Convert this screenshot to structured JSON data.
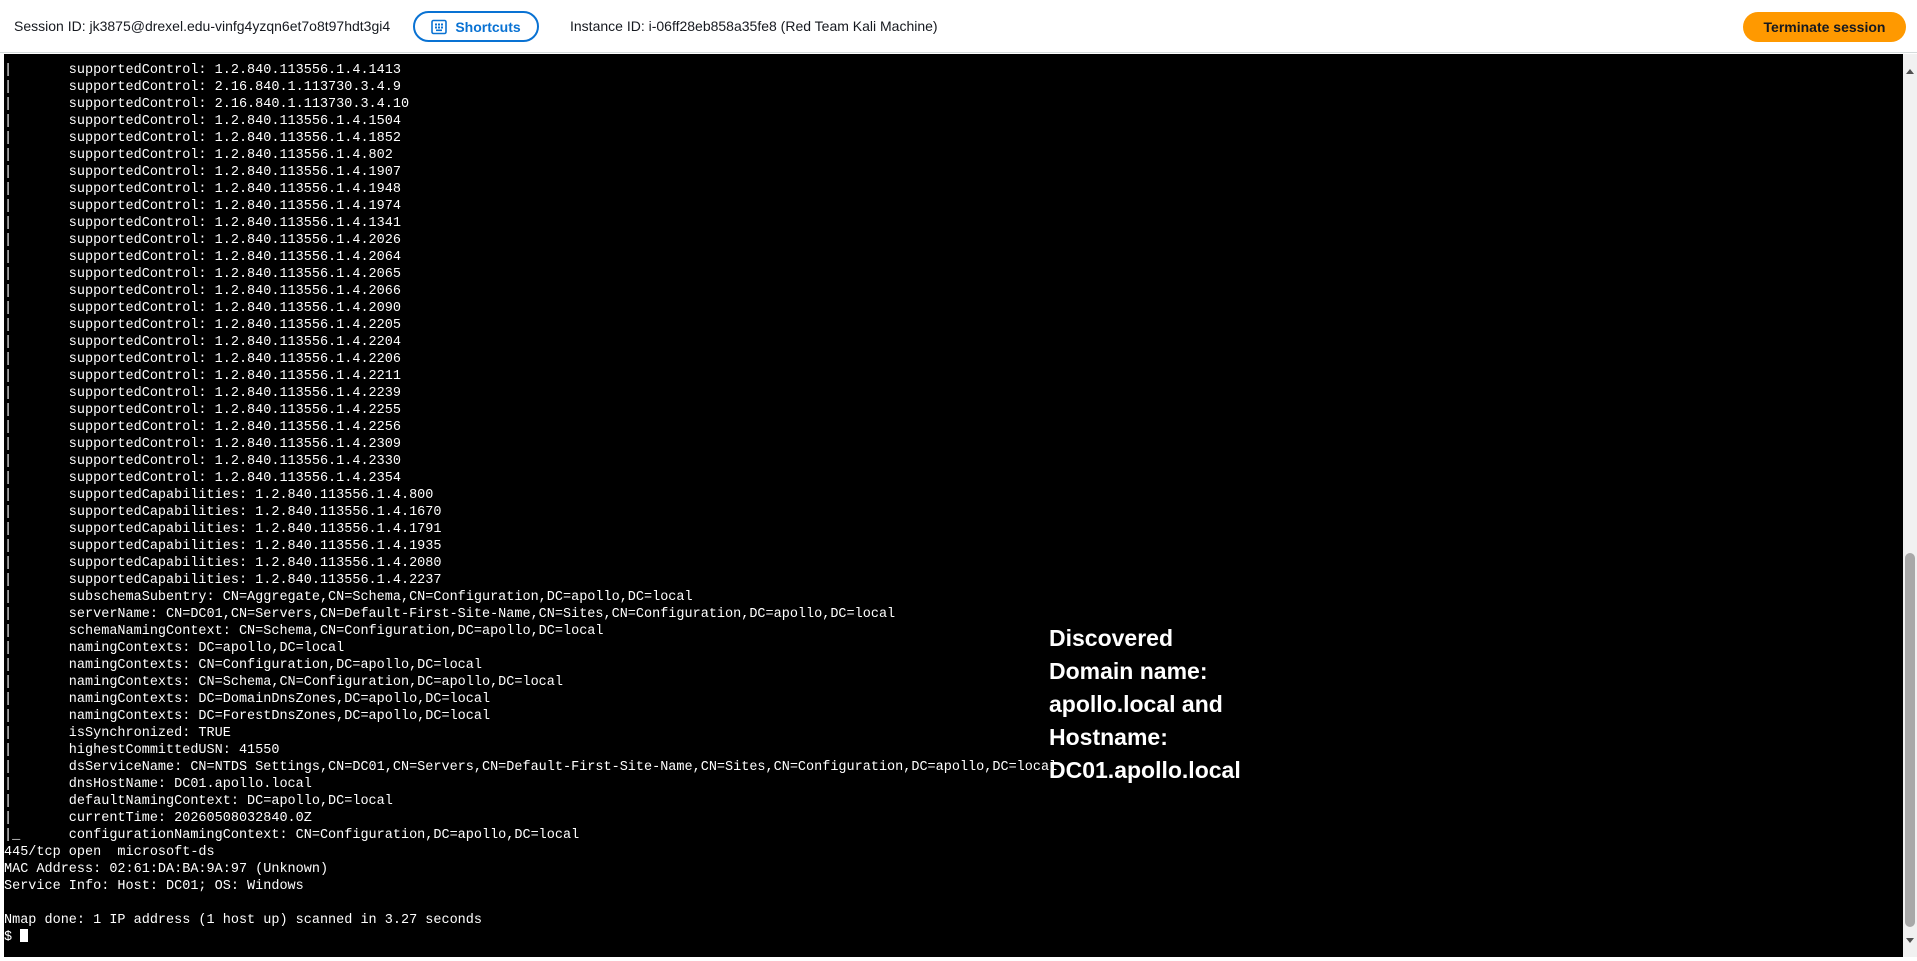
{
  "header": {
    "session_id": "Session ID: jk3875@drexel.edu-vinfg4yzqn6et7o8t97hdt3gi4",
    "shortcuts_label": "Shortcuts",
    "instance_id": "Instance ID: i-06ff28eb858a35fe8 (Red Team Kali Machine)",
    "terminate_label": "Terminate session"
  },
  "terminal": {
    "lines": [
      "|       supportedControl: 1.2.840.113556.1.4.1413",
      "|       supportedControl: 2.16.840.1.113730.3.4.9",
      "|       supportedControl: 2.16.840.1.113730.3.4.10",
      "|       supportedControl: 1.2.840.113556.1.4.1504",
      "|       supportedControl: 1.2.840.113556.1.4.1852",
      "|       supportedControl: 1.2.840.113556.1.4.802",
      "|       supportedControl: 1.2.840.113556.1.4.1907",
      "|       supportedControl: 1.2.840.113556.1.4.1948",
      "|       supportedControl: 1.2.840.113556.1.4.1974",
      "|       supportedControl: 1.2.840.113556.1.4.1341",
      "|       supportedControl: 1.2.840.113556.1.4.2026",
      "|       supportedControl: 1.2.840.113556.1.4.2064",
      "|       supportedControl: 1.2.840.113556.1.4.2065",
      "|       supportedControl: 1.2.840.113556.1.4.2066",
      "|       supportedControl: 1.2.840.113556.1.4.2090",
      "|       supportedControl: 1.2.840.113556.1.4.2205",
      "|       supportedControl: 1.2.840.113556.1.4.2204",
      "|       supportedControl: 1.2.840.113556.1.4.2206",
      "|       supportedControl: 1.2.840.113556.1.4.2211",
      "|       supportedControl: 1.2.840.113556.1.4.2239",
      "|       supportedControl: 1.2.840.113556.1.4.2255",
      "|       supportedControl: 1.2.840.113556.1.4.2256",
      "|       supportedControl: 1.2.840.113556.1.4.2309",
      "|       supportedControl: 1.2.840.113556.1.4.2330",
      "|       supportedControl: 1.2.840.113556.1.4.2354",
      "|       supportedCapabilities: 1.2.840.113556.1.4.800",
      "|       supportedCapabilities: 1.2.840.113556.1.4.1670",
      "|       supportedCapabilities: 1.2.840.113556.1.4.1791",
      "|       supportedCapabilities: 1.2.840.113556.1.4.1935",
      "|       supportedCapabilities: 1.2.840.113556.1.4.2080",
      "|       supportedCapabilities: 1.2.840.113556.1.4.2237",
      "|       subschemaSubentry: CN=Aggregate,CN=Schema,CN=Configuration,DC=apollo,DC=local",
      "|       serverName: CN=DC01,CN=Servers,CN=Default-First-Site-Name,CN=Sites,CN=Configuration,DC=apollo,DC=local",
      "|       schemaNamingContext: CN=Schema,CN=Configuration,DC=apollo,DC=local",
      "|       namingContexts: DC=apollo,DC=local",
      "|       namingContexts: CN=Configuration,DC=apollo,DC=local",
      "|       namingContexts: CN=Schema,CN=Configuration,DC=apollo,DC=local",
      "|       namingContexts: DC=DomainDnsZones,DC=apollo,DC=local",
      "|       namingContexts: DC=ForestDnsZones,DC=apollo,DC=local",
      "|       isSynchronized: TRUE",
      "|       highestCommittedUSN: 41550",
      "|       dsServiceName: CN=NTDS Settings,CN=DC01,CN=Servers,CN=Default-First-Site-Name,CN=Sites,CN=Configuration,DC=apollo,DC=local",
      "|       dnsHostName: DC01.apollo.local",
      "|       defaultNamingContext: DC=apollo,DC=local",
      "|       currentTime: 20260508032840.0Z",
      "|_      configurationNamingContext: CN=Configuration,DC=apollo,DC=local",
      "445/tcp open  microsoft-ds",
      "MAC Address: 02:61:DA:BA:9A:97 (Unknown)",
      "Service Info: Host: DC01; OS: Windows",
      "",
      "Nmap done: 1 IP address (1 host up) scanned in 3.27 seconds",
      "$ "
    ]
  },
  "annotation": {
    "lines": [
      "Discovered",
      "Domain name:",
      "apollo.local and",
      "Hostname:",
      "DC01.apollo.local"
    ]
  },
  "colors": {
    "accent": "#0972d3",
    "terminate_bg": "#ff9900",
    "terminal_bg": "#000000",
    "terminal_fg": "#ffffff"
  },
  "icons": {
    "shortcuts": "keyboard-icon"
  }
}
